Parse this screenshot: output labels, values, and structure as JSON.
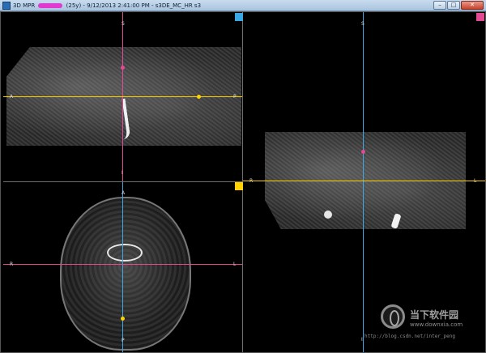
{
  "window": {
    "title_prefix": "3D MPR",
    "title_suffix": "(25y) - 9/12/2013 2:41:00 PM - s3DE_MC_HR s3",
    "minimize": "–",
    "maximize": "□",
    "close": "✕"
  },
  "colors": {
    "axial_line": "#ffd200",
    "coronal_line": "#3aa7e6",
    "sagittal_line": "#e44a93",
    "background": "#000000"
  },
  "panes": {
    "coronal": {
      "top": "S",
      "left": "A",
      "right": "P",
      "bottom": "I"
    },
    "sagittal": {
      "top": "S",
      "left": "R",
      "right": "L",
      "bottom": "I"
    },
    "axial": {
      "top": "A",
      "left": "R",
      "right": "L",
      "bottom": "P"
    }
  },
  "watermark": {
    "brand": "当下软件园",
    "url": "www.downxia.com",
    "blog": "http://blog.csdn.net/inter_peng"
  }
}
